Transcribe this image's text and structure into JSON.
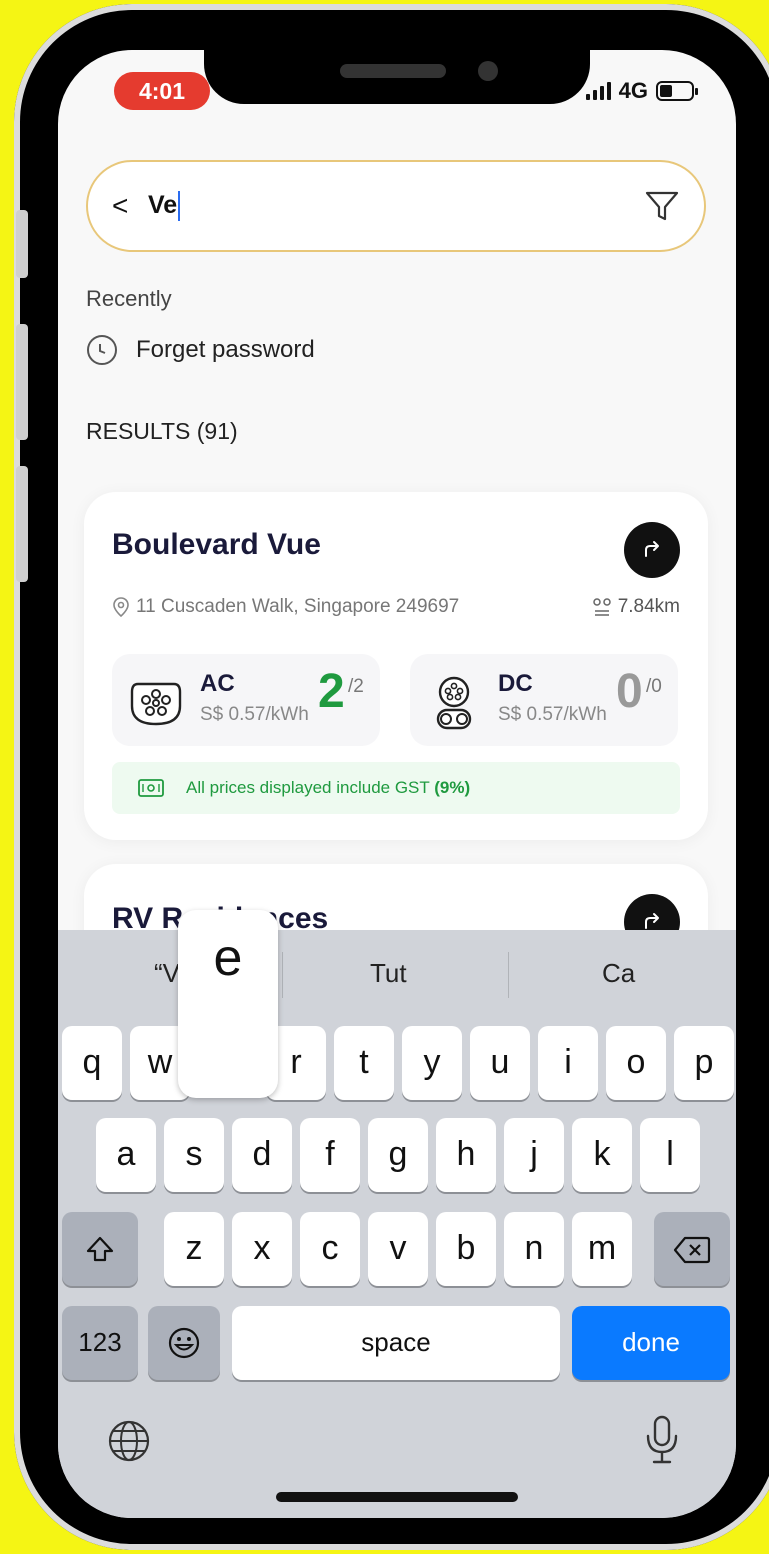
{
  "status": {
    "time": "4:01",
    "network": "4G"
  },
  "search": {
    "back_icon": "<",
    "query": "Ve"
  },
  "recent": {
    "title": "Recently",
    "items": [
      {
        "label": "Forget password"
      }
    ]
  },
  "results": {
    "title": "RESULTS (91)",
    "cards": [
      {
        "name": "Boulevard Vue",
        "address": "11 Cuscaden Walk, Singapore 249697",
        "distance": "7.84km",
        "ac": {
          "type": "AC",
          "price": "S$ 0.57/kWh",
          "available": "2",
          "total": "/2"
        },
        "dc": {
          "type": "DC",
          "price": "S$ 0.57/kWh",
          "available": "0",
          "total": "/0"
        },
        "gst_note": "All prices displayed include GST",
        "gst_rate": "(9%)"
      },
      {
        "name": "RV Residences"
      }
    ]
  },
  "keyboard": {
    "suggestions": [
      "“Ve”",
      "Tut",
      "Ca"
    ],
    "popup_key": "e",
    "row1": [
      "q",
      "w",
      "e",
      "r",
      "t",
      "y",
      "u",
      "i",
      "o",
      "p"
    ],
    "row2": [
      "a",
      "s",
      "d",
      "f",
      "g",
      "h",
      "j",
      "k",
      "l"
    ],
    "row3": [
      "z",
      "x",
      "c",
      "v",
      "b",
      "n",
      "m"
    ],
    "numbers_label": "123",
    "space_label": "space",
    "done_label": "done"
  },
  "colors": {
    "background": "#f5f514",
    "accent_green": "#1f9a3f",
    "done_blue": "#0a7aff",
    "time_pill": "#e53b2f"
  }
}
